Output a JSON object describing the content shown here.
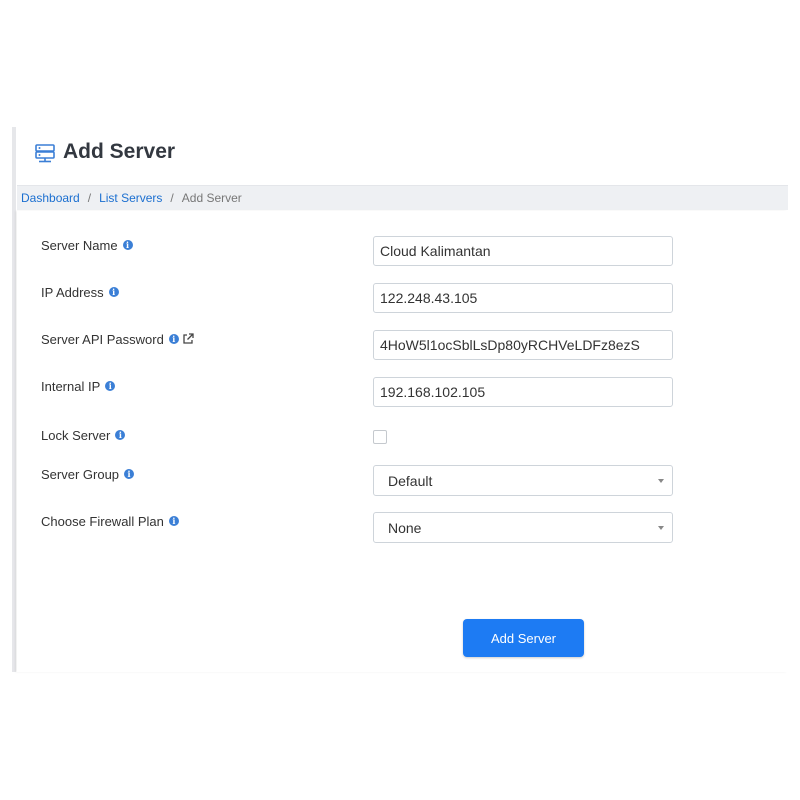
{
  "page": {
    "title": "Add Server",
    "title_icon": "server-icon"
  },
  "breadcrumb": {
    "items": [
      {
        "label": "Dashboard"
      },
      {
        "label": "List Servers"
      },
      {
        "label": "Add Server"
      }
    ],
    "separator": "/"
  },
  "form": {
    "server_name": {
      "label": "Server Name",
      "value": "Cloud Kalimantan"
    },
    "ip_address": {
      "label": "IP Address",
      "value": "122.248.43.105"
    },
    "api_password": {
      "label": "Server API Password",
      "value": "4HoW5l1ocSblLsDp80yRCHVeLDFz8ezS"
    },
    "internal_ip": {
      "label": "Internal IP",
      "value": "192.168.102.105"
    },
    "lock_server": {
      "label": "Lock Server",
      "checked": false
    },
    "server_group": {
      "label": "Server Group",
      "value": "Default"
    },
    "firewall_plan": {
      "label": "Choose Firewall Plan",
      "value": "None"
    },
    "info_glyph": "i",
    "submit_label": "Add Server"
  },
  "colors": {
    "accent": "#1d7bf3",
    "link": "#1b6fd0",
    "info_icon": "#3b7fd6"
  }
}
